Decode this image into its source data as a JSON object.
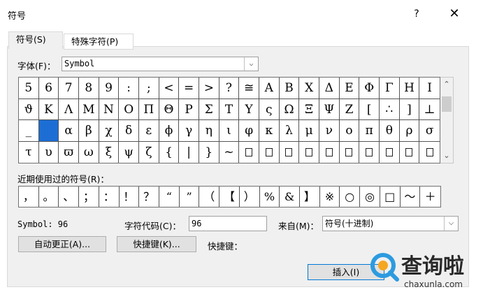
{
  "window": {
    "title": "符号",
    "help": "?",
    "close": "✕"
  },
  "tabs": [
    {
      "label": "符号(S)",
      "active": true
    },
    {
      "label": "特殊字符(P)",
      "active": false
    }
  ],
  "font": {
    "label": "字体(F)：",
    "value": "Symbol"
  },
  "grid": {
    "rows": [
      [
        "5",
        "6",
        "7",
        "8",
        "9",
        ":",
        ";",
        "<",
        "=",
        ">",
        "?",
        "≅",
        "Α",
        "Β",
        "Χ",
        "Δ",
        "Ε",
        "Φ",
        "Γ",
        "Η",
        "Ι"
      ],
      [
        "ϑ",
        "Κ",
        "Λ",
        "Μ",
        "Ν",
        "Ο",
        "Π",
        "Θ",
        "Ρ",
        "Σ",
        "Τ",
        "Υ",
        "ς",
        "Ω",
        "Ξ",
        "Ψ",
        "Ζ",
        "[",
        "∴",
        "]",
        "⊥"
      ],
      [
        "_",
        "",
        "α",
        "β",
        "χ",
        "δ",
        "ε",
        "ϕ",
        "γ",
        "η",
        "ι",
        "φ",
        "κ",
        "λ",
        "μ",
        "ν",
        "ο",
        "π",
        "θ",
        "ρ",
        "σ"
      ],
      [
        "τ",
        "υ",
        "ϖ",
        "ω",
        "ξ",
        "ψ",
        "ζ",
        "{",
        "|",
        "}",
        "~",
        "□",
        "□",
        "□",
        "□",
        "□",
        "□",
        "□",
        "□",
        "□",
        "□"
      ]
    ],
    "selected": {
      "row": 2,
      "col": 1
    }
  },
  "recent": {
    "label": "近期使用过的符号(R)：",
    "items": [
      "，",
      "。",
      "、",
      "；",
      "：",
      "！",
      "？",
      "“",
      "”",
      "（",
      "【",
      "）",
      "%",
      "&",
      "】",
      "※",
      "○",
      "◎",
      "□",
      "～",
      "＋"
    ]
  },
  "info": {
    "symbol_name": "Symbol: 96",
    "charcode_label": "字符代码(C)：",
    "charcode_value": "96",
    "from_label": "来自(M)：",
    "from_value": "符号(十进制)"
  },
  "buttons": {
    "autocorrect": "自动更正(A)...",
    "shortcut": "快捷键(K)...",
    "shortcut_label": "快捷键：",
    "insert": "插入(I)"
  },
  "watermark": {
    "text": "查询啦",
    "url": "chaxunla.com"
  },
  "colors": {
    "selected": "#1c6ed4",
    "panel": "#f0f0f0"
  }
}
